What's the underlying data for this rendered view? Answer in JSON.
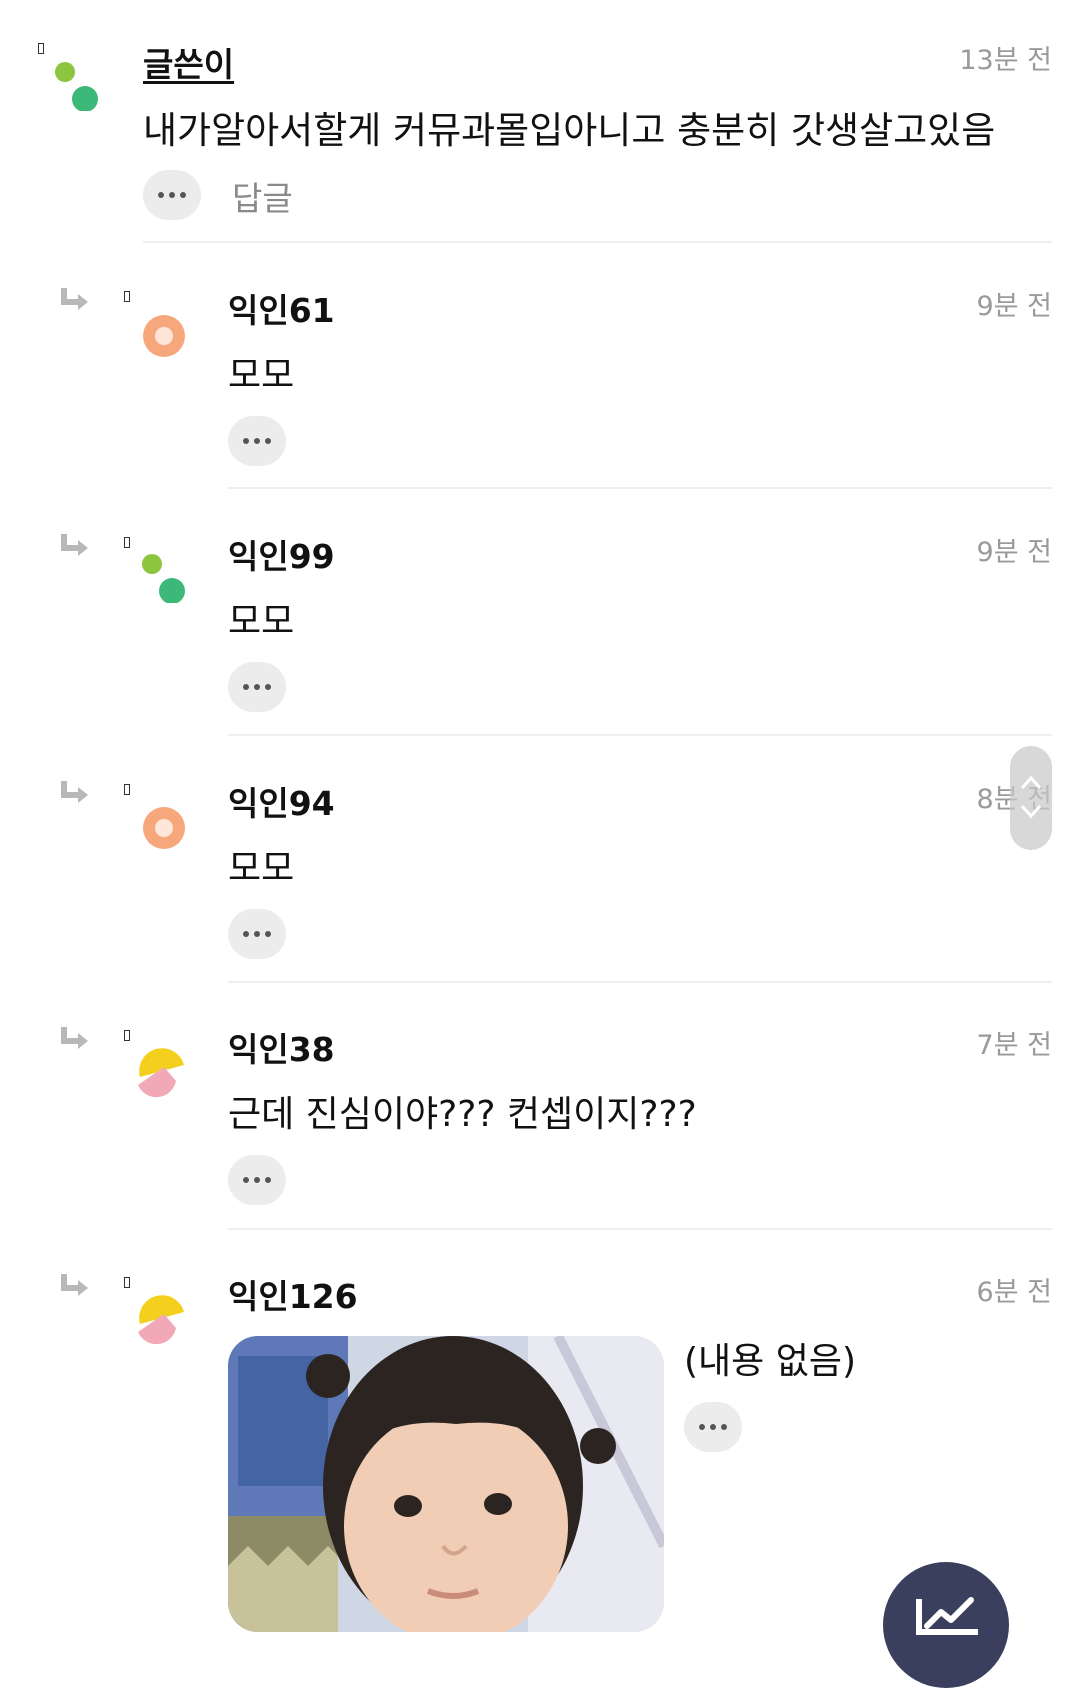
{
  "comments": [
    {
      "author": "글쓴이",
      "time": "13분 전",
      "text": "내가알아서할게 커뮤과몰입아니고 충분히 갓생살고있음",
      "reply_label": "답글",
      "avatar": "green-dots"
    },
    {
      "author": "익인61",
      "time": "9분 전",
      "text": "모모",
      "avatar": "orange-ring"
    },
    {
      "author": "익인99",
      "time": "9분 전",
      "text": "모모",
      "avatar": "green-dots"
    },
    {
      "author": "익인94",
      "time": "8분 전",
      "text": "모모",
      "avatar": "orange-ring"
    },
    {
      "author": "익인38",
      "time": "7분 전",
      "text": "근데 진심이야??? 컨셉이지???",
      "avatar": "yellow-pink-split"
    },
    {
      "author": "익인126",
      "time": "6분 전",
      "text": "(내용 없음)",
      "avatar": "yellow-pink-split",
      "attachment": "photo of a young child with pigtails"
    }
  ],
  "icons": {
    "more": "more-dots-icon",
    "reply": "reply-arrow-icon",
    "scroll": "scroll-up-down-icon",
    "fab": "chart-trend-icon"
  },
  "colors": {
    "green_light": "#8cc63f",
    "green_dark": "#3cb878",
    "orange": "#f7a77c",
    "yellow": "#f5cf1e",
    "pink": "#f2a9b7",
    "fab": "#3a3f5e"
  }
}
